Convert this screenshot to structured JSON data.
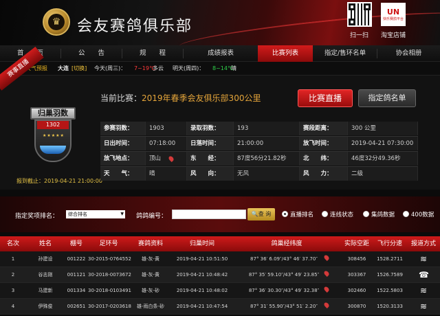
{
  "header": {
    "title": "会友赛鸽俱乐部",
    "scan_label": "扫一扫",
    "shop_label": "淘宝店铺",
    "shop_mark": "UN",
    "shop_sub": "快乐赛鸽平台"
  },
  "nav": {
    "items": [
      "首　　页",
      "公　　告",
      "规　　程",
      "成绩报表",
      "比赛列表",
      "指定/售环名单",
      "协会相册"
    ],
    "active_index": 4
  },
  "weather": {
    "label": "天气预报",
    "city": "大连",
    "tag": "[切换]",
    "today_label": "今天(周三)：",
    "today_range": "7~19℃",
    "today_desc": "多云",
    "tomorrow_label": "明天(周四)：",
    "tomorrow_range": "8~14℃",
    "tomorrow_desc": "晴"
  },
  "live": {
    "ribbon": "赛事直播",
    "badge_title": "归巢羽数",
    "badge_count": "1302",
    "badge_stars": "★★★★★",
    "deadline": "报到截止：2019-04-21 21:00:00",
    "current_label": "当前比赛：",
    "current_race": "2019年春季会友俱乐部300公里",
    "btn_live": "比赛直播",
    "btn_roster": "指定鸽名单",
    "rows": [
      [
        [
          "参赛羽数：",
          "1903"
        ],
        [
          "录取羽数：",
          "193"
        ],
        [
          "赛段距离：",
          "300 公里"
        ]
      ],
      [
        [
          "日出时间：",
          "07:18:00"
        ],
        [
          "日落时间：",
          "21:00:00"
        ],
        [
          "放飞时间：",
          "2019-04-21 07:30:00"
        ]
      ],
      [
        [
          "放飞地点：",
          "顶山"
        ],
        [
          "东　　经：",
          "87度56分21.82秒"
        ],
        [
          "北　　纬：",
          "46度32分49.36秒"
        ]
      ],
      [
        [
          "天　　气：",
          "晴"
        ],
        [
          "风　　向：",
          "无风"
        ],
        [
          "风　　力：",
          "二级"
        ]
      ]
    ]
  },
  "filter": {
    "rank_label": "指定奖项排名：",
    "rank_value": "综合排名",
    "pigeon_label": "鸽鸽编号：",
    "search_label": "查 询",
    "radios": [
      "直播排名",
      "连线状态",
      "集鸽数据",
      "400数据"
    ]
  },
  "table": {
    "headers": [
      "名次",
      "姓名",
      "棚号",
      "足环号",
      "赛鸽资料",
      "归巢时间",
      "鸽巢经纬度",
      "实际空距",
      "飞行分速",
      "报道方式"
    ],
    "rows": [
      [
        "1",
        "孙建设",
        "001222",
        "30-2015-0764552",
        "雄-灰-黄",
        "2019-04-21 10:51:50",
        "87° 36′ 6.09″/43° 46′ 37.70″",
        "308456",
        "1528.2711"
      ],
      [
        "2",
        "谷志刚",
        "001121",
        "30-2018-0073672",
        "雄-灰-黄",
        "2019-04-21 10:48:42",
        "87° 35′ 59.10″/43° 49′ 23.85″",
        "303367",
        "1526.7589"
      ],
      [
        "3",
        "马建新",
        "001334",
        "30-2018-0103491",
        "雄-灰-砂",
        "2019-04-21 10:48:02",
        "87° 36′ 30.30″/43° 49′ 32.38″",
        "302460",
        "1522.5803"
      ],
      [
        "4",
        "伊殊俊",
        "002651",
        "30-2017-0203618",
        "雄-雨白条-砂",
        "2019-04-21 10:47:54",
        "87° 31′ 55.90″/43° 51′ 2.20″",
        "300870",
        "1520.3133"
      ]
    ]
  },
  "colors": {
    "accent": "#c81a1a",
    "gold": "#e5a53a",
    "pin": "#d43a3a"
  }
}
